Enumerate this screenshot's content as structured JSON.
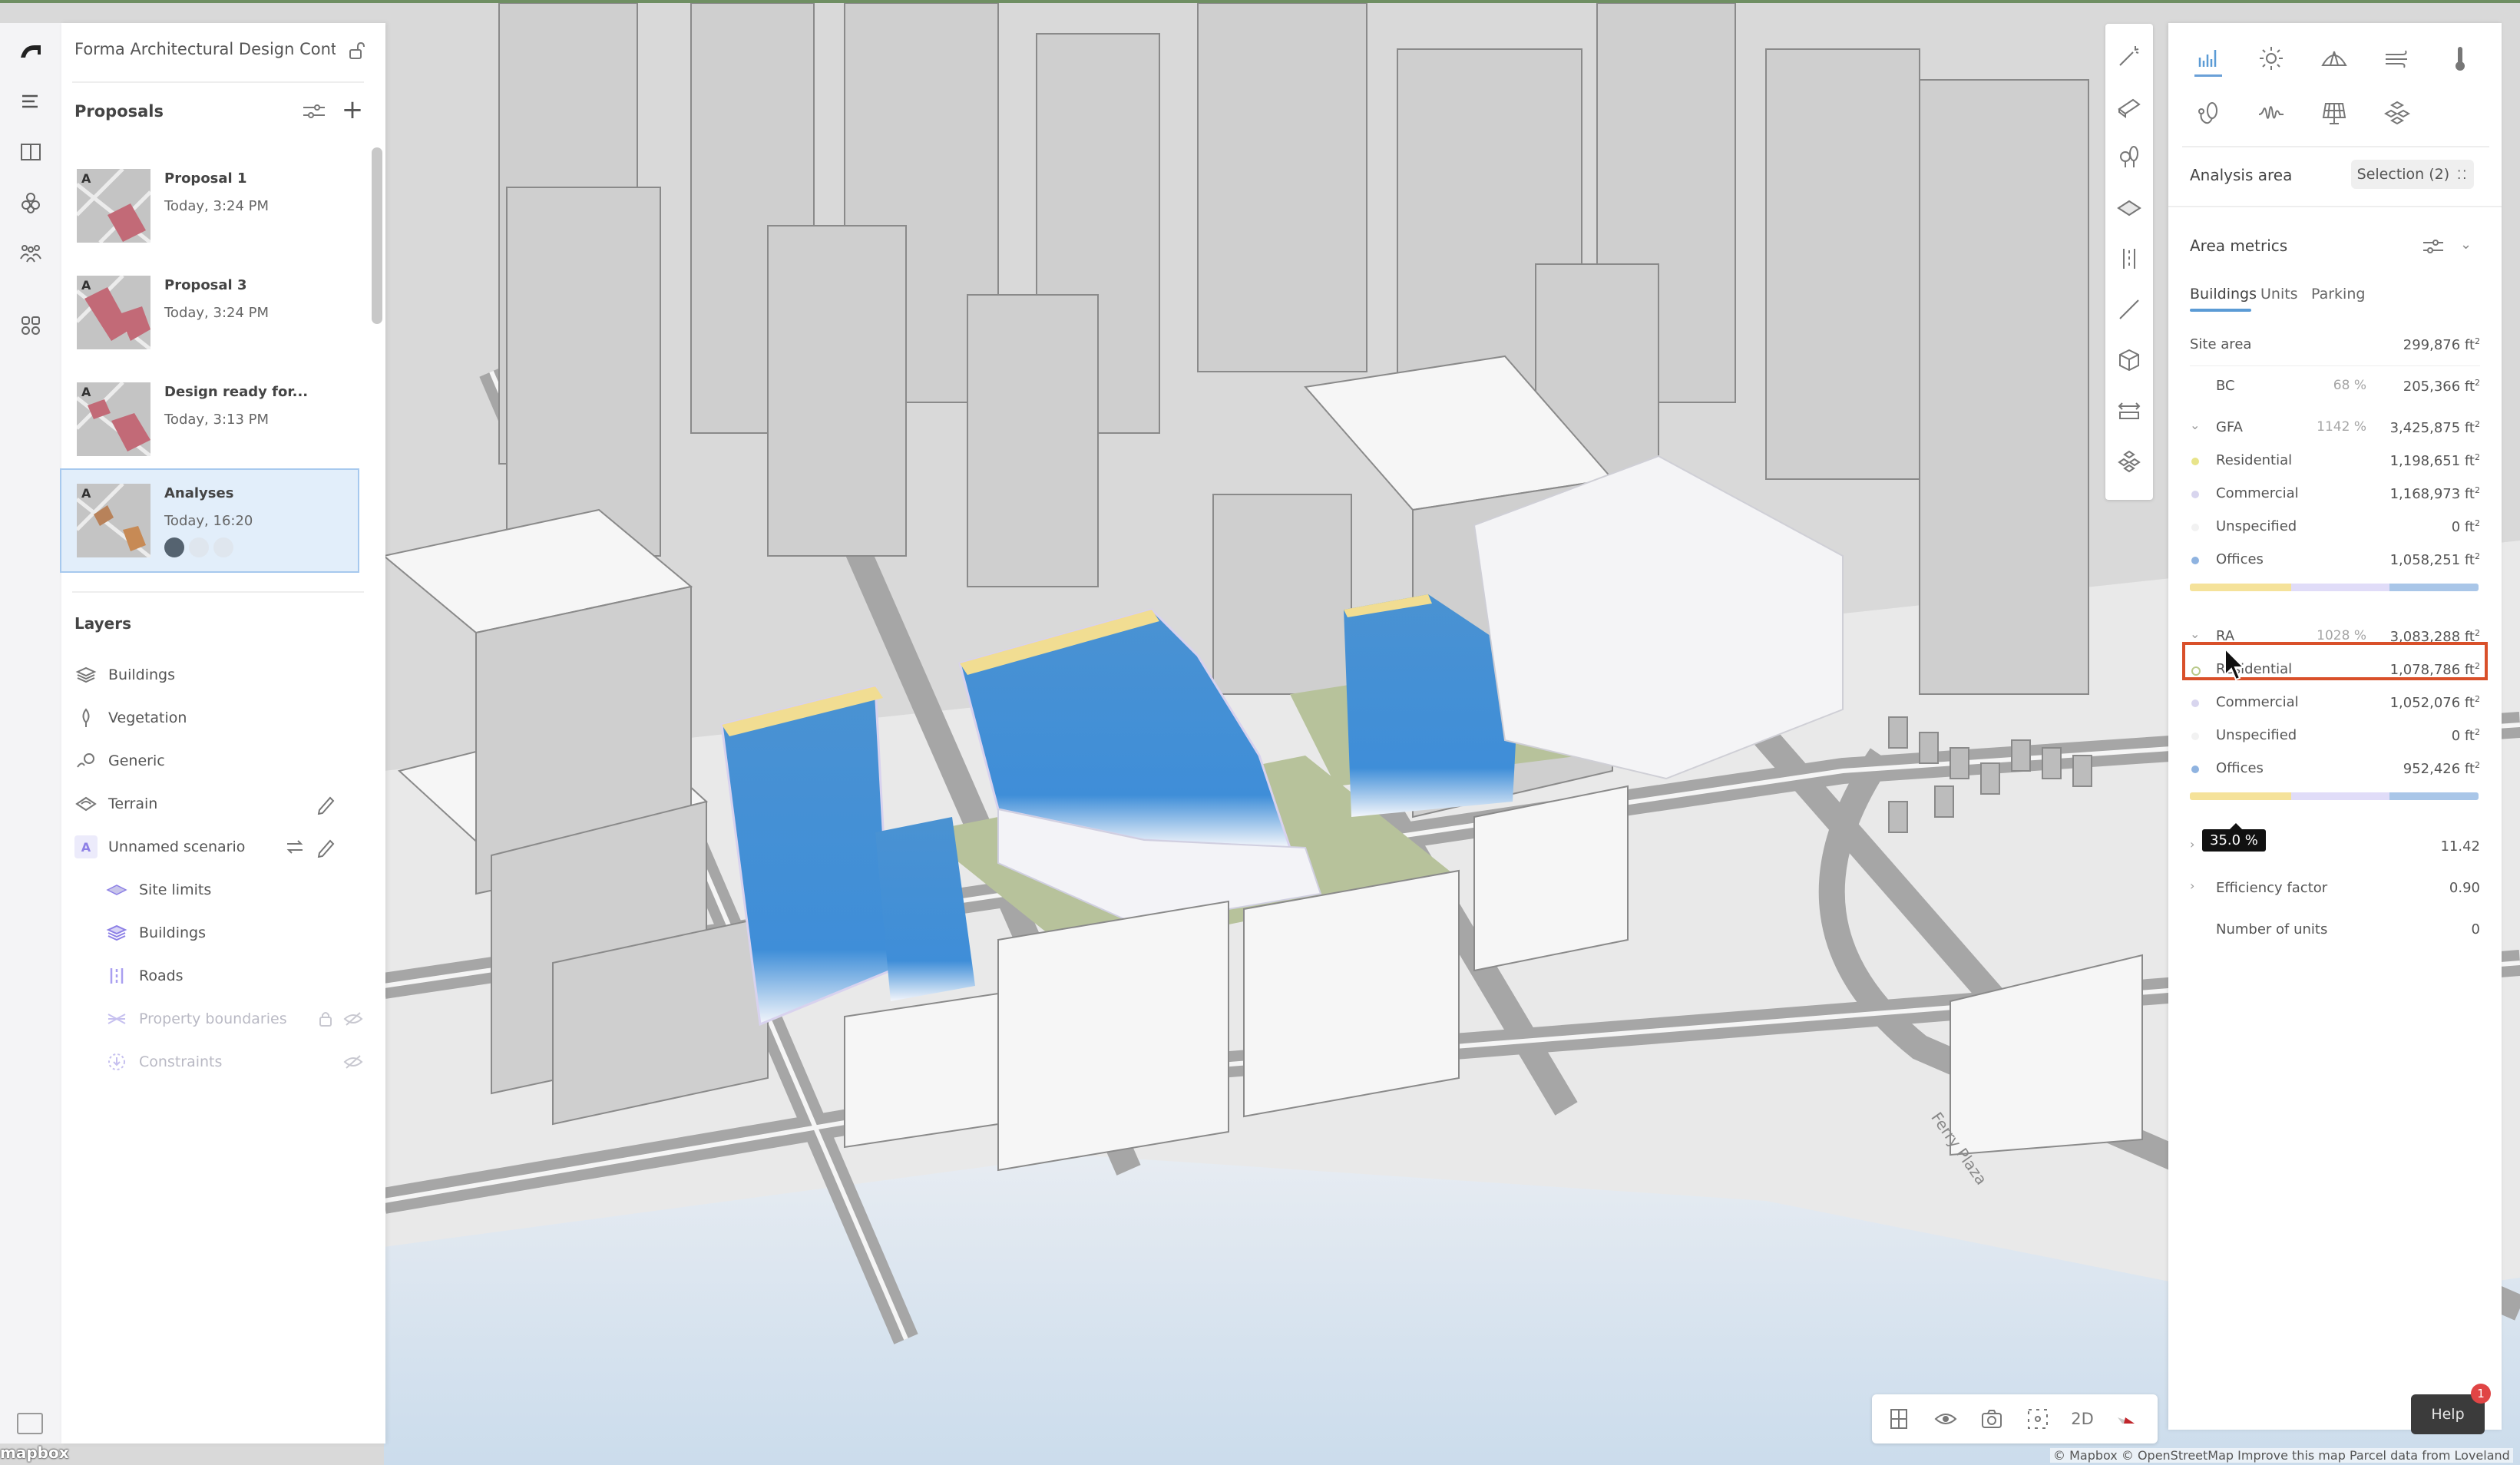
{
  "app": {
    "project_title": "Forma Architectural Design Conte...",
    "accent_color": "#5b9bd5",
    "highlight_color": "#d9502a"
  },
  "rail": {
    "items": [
      {
        "icon": "forma-logo-icon"
      },
      {
        "icon": "menu-icon"
      },
      {
        "icon": "book-icon"
      },
      {
        "icon": "cubes-icon"
      },
      {
        "icon": "people-icon"
      },
      {
        "icon": "apps-icon"
      }
    ],
    "bottom_icon": "keyboard-icon"
  },
  "proposals": {
    "title": "Proposals",
    "items": [
      {
        "name": "Proposal 1",
        "time": "Today, 3:24 PM",
        "badge": "A",
        "selected": false
      },
      {
        "name": "Proposal 3",
        "time": "Today, 3:24 PM",
        "badge": "A",
        "selected": false
      },
      {
        "name": "Design ready for...",
        "time": "Today, 3:13 PM",
        "badge": "A",
        "selected": false
      },
      {
        "name": "Analyses",
        "time": "Today, 16:20",
        "badge": "A",
        "selected": true
      }
    ]
  },
  "layers": {
    "title": "Layers",
    "items": [
      {
        "label": "Buildings",
        "icon": "buildings-icon"
      },
      {
        "label": "Vegetation",
        "icon": "tree-icon"
      },
      {
        "label": "Generic",
        "icon": "generic-icon"
      },
      {
        "label": "Terrain",
        "icon": "terrain-icon",
        "action": "edit"
      },
      {
        "label": "Unnamed scenario",
        "badge": "A",
        "actions": [
          "swap",
          "edit"
        ]
      }
    ],
    "sub_items": [
      {
        "label": "Site limits",
        "icon": "site-limits-icon"
      },
      {
        "label": "Buildings",
        "icon": "buildings-icon"
      },
      {
        "label": "Roads",
        "icon": "roads-icon"
      },
      {
        "label": "Property boundaries",
        "icon": "property-boundaries-icon",
        "dimmed": true,
        "actions": [
          "lock",
          "hidden"
        ]
      },
      {
        "label": "Constraints",
        "icon": "constraints-icon",
        "dimmed": true,
        "actions": [
          "hidden"
        ]
      }
    ]
  },
  "tool_column": {
    "items": [
      "magic-wand-icon",
      "building-block-icon",
      "trees-icon",
      "site-icon",
      "road-icon",
      "line-icon",
      "cube-icon",
      "resize-icon",
      "stack-icon"
    ]
  },
  "analysis": {
    "icons": [
      "bar-chart-icon",
      "sun-icon",
      "sky-dome-icon",
      "wind-icon",
      "thermometer-icon",
      "sustainability-icon",
      "noise-icon",
      "solar-panel-icon",
      "volume-icon"
    ],
    "active_icon": "bar-chart-icon",
    "area_label": "Analysis area",
    "selection_label": "Selection (2)"
  },
  "area_metrics": {
    "title": "Area metrics",
    "tabs": [
      "Buildings",
      "Units",
      "Parking"
    ],
    "active_tab": "Buildings",
    "site_area": {
      "label": "Site area",
      "value": "299,876 ft",
      "unit_sup": "2"
    },
    "bc": {
      "label": "BC",
      "pct": "68 %",
      "value": "205,366 ft",
      "unit_sup": "2"
    },
    "gfa": {
      "label": "GFA",
      "pct": "1142 %",
      "value": "3,425,875 ft",
      "unit_sup": "2",
      "rows": [
        {
          "label": "Residential",
          "value": "1,198,651 ft",
          "color": "#e8e48a"
        },
        {
          "label": "Commercial",
          "value": "1,168,973 ft",
          "color": "#d8d5ee"
        },
        {
          "label": "Unspecified",
          "value": "0 ft",
          "color": "#f2f2f2"
        },
        {
          "label": "Offices",
          "value": "1,058,251 ft",
          "color": "#8fb3e0"
        }
      ],
      "bar_shares": [
        0.35,
        0.341,
        0.0,
        0.309
      ],
      "bar_colors": [
        "#f5e29a",
        "#e0dcf8",
        "#f2f2f2",
        "#a9c6e8"
      ]
    },
    "ra": {
      "label": "RA",
      "pct": "1028 %",
      "value": "3,083,288 ft",
      "unit_sup": "2",
      "rows": [
        {
          "label": "Residential",
          "value": "1,078,786 ft",
          "color": "#b9c98a",
          "highlighted": true
        },
        {
          "label": "Commercial",
          "value": "1,052,076 ft",
          "color": "#d8d5ee"
        },
        {
          "label": "Unspecified",
          "value": "0 ft",
          "color": "#f2f2f2"
        },
        {
          "label": "Offices",
          "value": "952,426 ft",
          "color": "#8fb3e0"
        }
      ],
      "bar_shares": [
        0.35,
        0.341,
        0.0,
        0.309
      ],
      "bar_colors": [
        "#f5e29a",
        "#e0dcf8",
        "#f2f2f2",
        "#a9c6e8"
      ],
      "tooltip": "35.0 %"
    },
    "far": {
      "value": "11.42"
    },
    "efficiency": {
      "label": "Efficiency factor",
      "value": "0.90"
    },
    "units": {
      "label": "Number of units",
      "value": "0"
    }
  },
  "bottom_toolbar": {
    "items": [
      "floor-plan-icon",
      "eye-icon",
      "camera-icon",
      "focus-icon"
    ],
    "mode_label": "2D",
    "compass_icon": "compass-icon"
  },
  "help": {
    "label": "Help",
    "badge_count": "1"
  },
  "map": {
    "street_label": "Ferry Plaza",
    "attribution": "© Mapbox © OpenStreetMap Improve this map Parcel data from Loveland",
    "logo": "mapbox"
  }
}
